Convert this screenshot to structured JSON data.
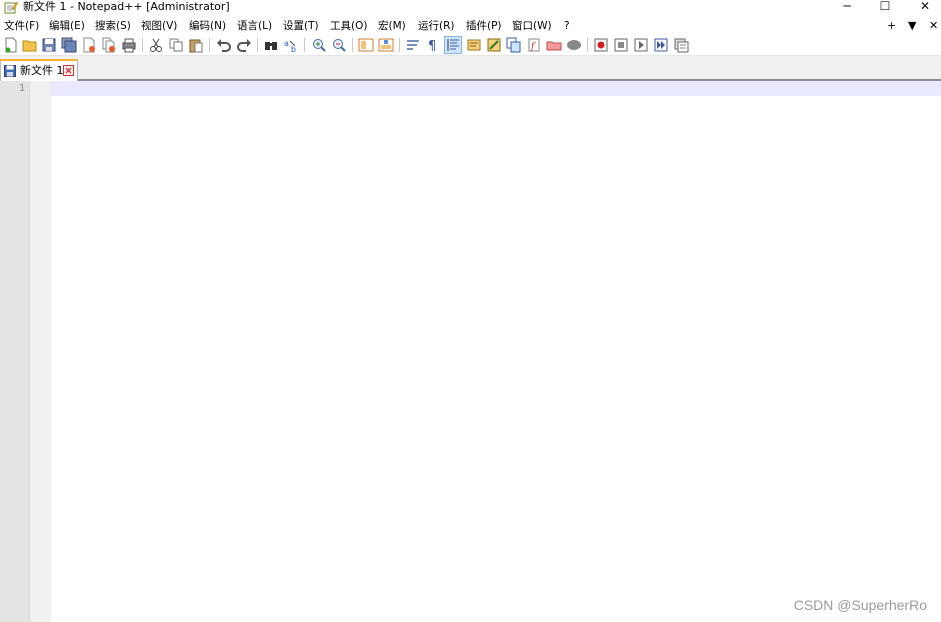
{
  "window": {
    "title": "新文件 1 - Notepad++ [Administrator]",
    "minimize_glyph": "─",
    "maximize_glyph": "☐",
    "close_glyph": "✕"
  },
  "menu": {
    "items": [
      "文件(F)",
      "编辑(E)",
      "搜索(S)",
      "视图(V)",
      "编码(N)",
      "语言(L)",
      "设置(T)",
      "工具(O)",
      "宏(M)",
      "运行(R)",
      "插件(P)",
      "窗口(W)",
      "?"
    ],
    "right_plus": "+",
    "right_down": "▼",
    "right_close": "✕"
  },
  "toolbar": {
    "icons": [
      "new-file-icon",
      "open-file-icon",
      "save-icon",
      "save-all-icon",
      "close-icon",
      "close-all-icon",
      "print-icon",
      "cut-icon",
      "copy-icon",
      "paste-icon",
      "undo-icon",
      "redo-icon",
      "find-icon",
      "replace-icon",
      "zoom-in-icon",
      "zoom-out-icon",
      "sync-vertical-icon",
      "sync-horizontal-icon",
      "word-wrap-icon",
      "show-all-chars-icon",
      "indent-guide-icon",
      "user-language-icon",
      "document-map-icon",
      "function-list-icon",
      "folder-workspace-icon",
      "monitoring-icon",
      "record-macro-icon",
      "stop-record-icon",
      "play-macro-icon",
      "run-macro-multiple-icon",
      "save-macro-icon"
    ]
  },
  "tab": {
    "label": "新文件 1"
  },
  "editor": {
    "line_number": "1",
    "content": ""
  },
  "colors": {
    "tab_accent": "#f7b12a",
    "current_line": "#e8e8ff",
    "gutter": "#e4e4e4"
  },
  "watermark": "CSDN @SuperherRo"
}
